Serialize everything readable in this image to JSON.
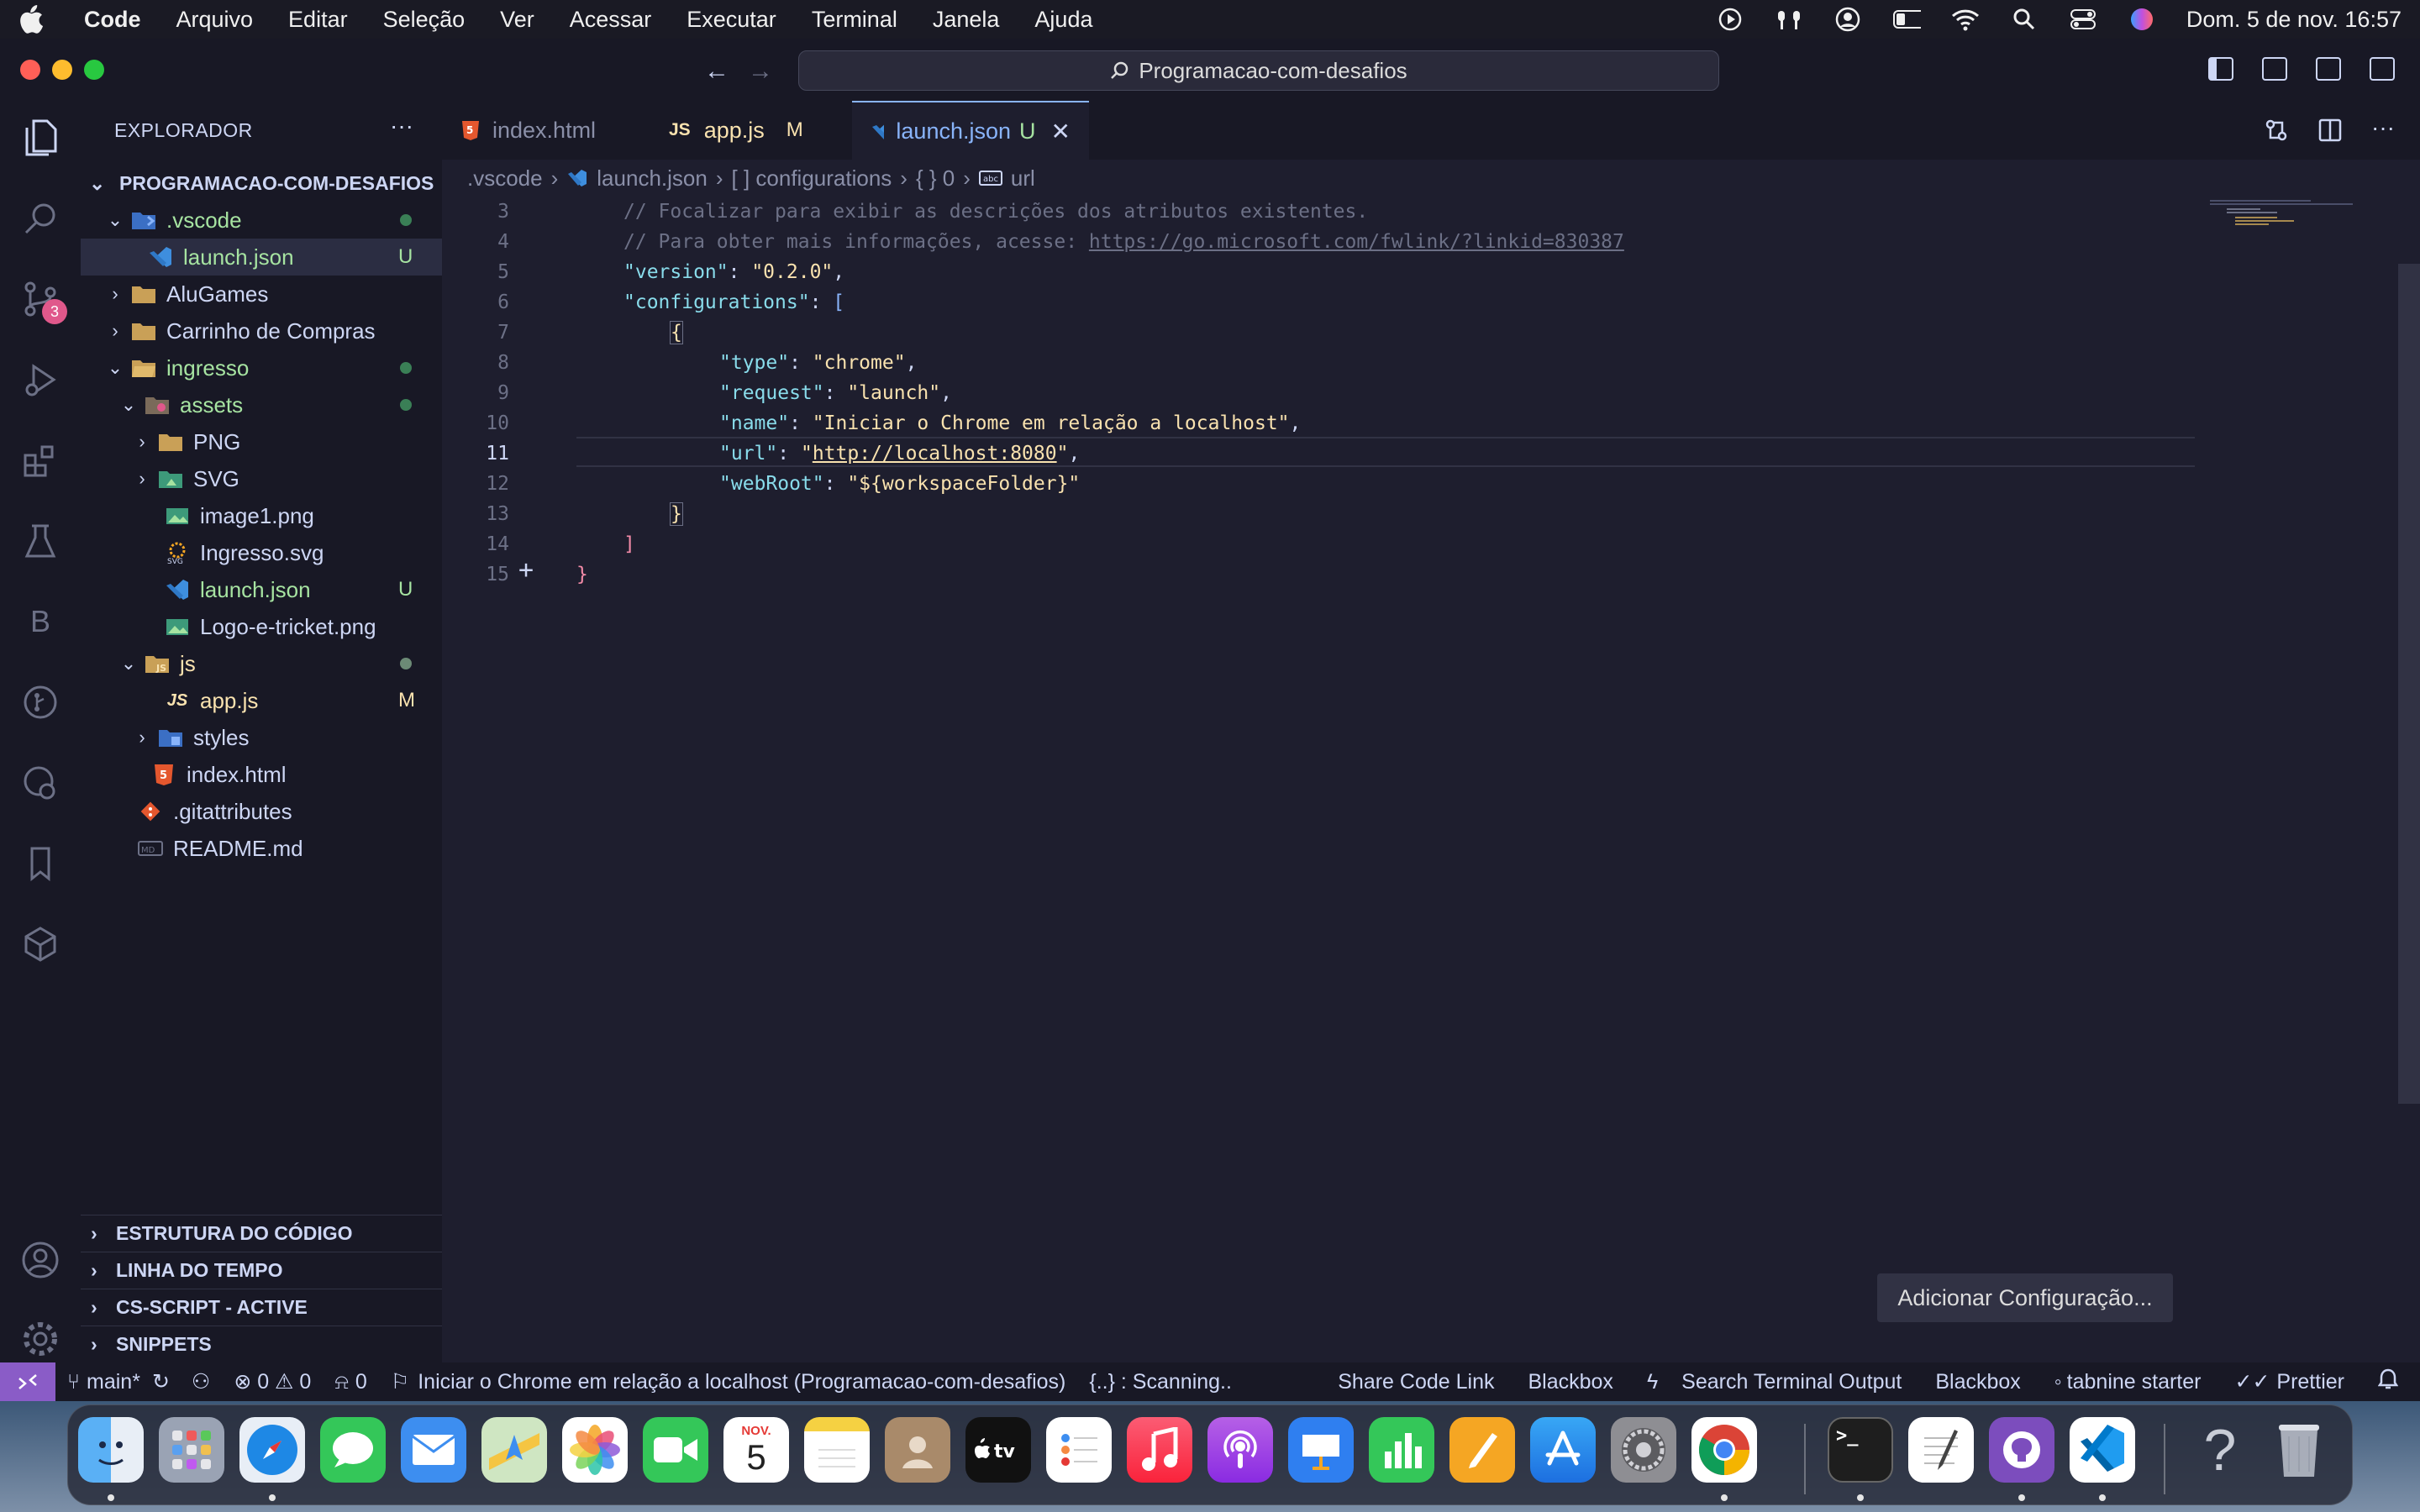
{
  "menubar": {
    "app": "Code",
    "items": [
      "Arquivo",
      "Editar",
      "Seleção",
      "Ver",
      "Acessar",
      "Executar",
      "Terminal",
      "Janela",
      "Ajuda"
    ],
    "clock": "Dom. 5 de nov.  16:57"
  },
  "titlebar": {
    "search": "Programacao-com-desafios"
  },
  "activity": {
    "scm_badge": "3"
  },
  "sidebar": {
    "title": "EXPLORADOR",
    "more": "···",
    "root": "PROGRAMACAO-COM-DESAFIOS",
    "tree": [
      {
        "label": ".vscode",
        "status": ""
      },
      {
        "label": "launch.json",
        "status": "U"
      },
      {
        "label": "AluGames",
        "status": ""
      },
      {
        "label": "Carrinho de Compras",
        "status": ""
      },
      {
        "label": "ingresso",
        "status": ""
      },
      {
        "label": "assets",
        "status": ""
      },
      {
        "label": "PNG",
        "status": ""
      },
      {
        "label": "SVG",
        "status": ""
      },
      {
        "label": "image1.png",
        "status": ""
      },
      {
        "label": "Ingresso.svg",
        "status": ""
      },
      {
        "label": "launch.json",
        "status": "U"
      },
      {
        "label": "Logo-e-tricket.png",
        "status": ""
      },
      {
        "label": "js",
        "status": ""
      },
      {
        "label": "app.js",
        "status": "M"
      },
      {
        "label": "styles",
        "status": ""
      },
      {
        "label": "index.html",
        "status": ""
      },
      {
        "label": ".gitattributes",
        "status": ""
      },
      {
        "label": "README.md",
        "status": ""
      }
    ],
    "sections": [
      "ESTRUTURA DO CÓDIGO",
      "LINHA DO TEMPO",
      "CS-SCRIPT - ACTIVE",
      "SNIPPETS"
    ]
  },
  "tabs": [
    {
      "label": "index.html",
      "status": ""
    },
    {
      "label": "app.js",
      "status": "M"
    },
    {
      "label": "launch.json",
      "status": "U"
    }
  ],
  "breadcrumb": [
    ".vscode",
    "launch.json",
    "[ ] configurations",
    "{ } 0",
    "url"
  ],
  "editor": {
    "line_numbers": [
      "3",
      "4",
      "5",
      "6",
      "7",
      "8",
      "9",
      "10",
      "11",
      "12",
      "13",
      "14",
      "15"
    ],
    "current_line": "11",
    "comment1": "// Focalizar para exibir as descrições dos atributos existentes.",
    "comment2_prefix": "// Para obter mais informações, acesse: ",
    "comment2_link": "https://go.microsoft.com/fwlink/?linkid=830387",
    "k_version": "\"version\"",
    "v_version": "\"0.2.0\"",
    "k_configurations": "\"configurations\"",
    "k_type": "\"type\"",
    "v_type": "\"chrome\"",
    "k_request": "\"request\"",
    "v_request": "\"launch\"",
    "k_name": "\"name\"",
    "v_name": "\"Iniciar o Chrome em relação a localhost\"",
    "k_url": "\"url\"",
    "v_url": "http://localhost:8080",
    "k_webroot": "\"webRoot\"",
    "v_webroot": "\"${workspaceFolder}\"",
    "add_config": "Adicionar Configuração..."
  },
  "statusbar": {
    "branch": "main*",
    "problems": "⊗ 0 ⚠ 0",
    "ports": "0",
    "launch": "Iniciar o Chrome em relação a localhost (Programacao-com-desafios)",
    "scanning": "{..} : Scanning..",
    "right": [
      "Share Code Link",
      "Blackbox",
      "Search Terminal Output",
      "Blackbox",
      "tabnine starter",
      "Prettier"
    ]
  },
  "dock": {
    "calendar_month": "NOV.",
    "calendar_day": "5",
    "apps": [
      "Finder",
      "Launchpad",
      "Safari",
      "Mensagens",
      "Mail",
      "Mapas",
      "Fotos",
      "FaceTime",
      "Calendário",
      "Notas",
      "Contatos",
      "TV",
      "Lembretes",
      "Música",
      "Podcasts",
      "Keynote",
      "Numbers",
      "Pages",
      "App Store",
      "Ajustes do Sistema",
      "Chrome",
      "Terminal",
      "TextEdit",
      "GitHub Desktop",
      "VS Code",
      "Ajuda",
      "Lixeira"
    ]
  },
  "colors": {
    "accent": "#89b4fa",
    "git_untracked": "#a6e3a1",
    "remote": "#8a5cc7",
    "badge": "#e0588b"
  }
}
